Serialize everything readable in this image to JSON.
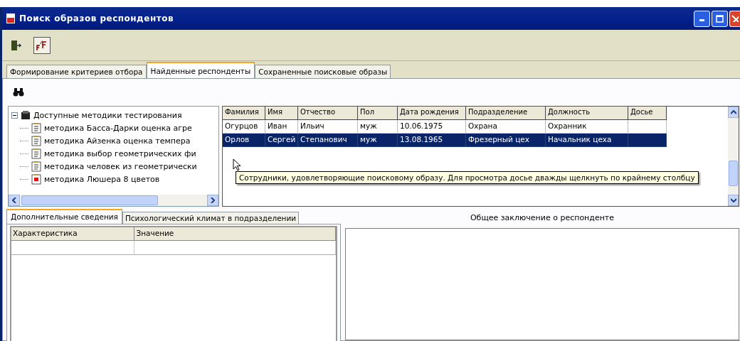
{
  "window": {
    "title": "Поиск образов респондентов"
  },
  "tabs": [
    {
      "label": "Формирование критериев отбора",
      "selected": false
    },
    {
      "label": "Найденные респонденты",
      "selected": true
    },
    {
      "label": "Сохраненные поисковые образы",
      "selected": false
    }
  ],
  "tree": {
    "label": "Доступные методики тестирования",
    "expanded": true,
    "children": [
      {
        "label": "методика Басса-Дарки оценка агре",
        "kind": "document"
      },
      {
        "label": "методика Айзенка оценка темпера",
        "kind": "document"
      },
      {
        "label": "методика выбор геометрических фи",
        "kind": "document"
      },
      {
        "label": "методика человек из геометрически",
        "kind": "document"
      },
      {
        "label": "методика Люшера 8 цветов",
        "kind": "color"
      }
    ]
  },
  "grid": {
    "columns": [
      "Фамилия",
      "Имя",
      "Отчество",
      "Пол",
      "Дата рождения",
      "Подразделение",
      "Должность",
      "Досье"
    ],
    "rows": [
      {
        "cells": [
          "Огурцов",
          "Иван",
          "Ильич",
          "муж",
          "10.06.1975",
          "Охрана",
          "Охранник"
        ],
        "selected": false
      },
      {
        "cells": [
          "Орлов",
          "Сергей",
          "Степанович",
          "муж",
          "13.08.1965",
          "Фрезерный цех",
          "Начальник цеха"
        ],
        "selected": true
      }
    ],
    "tooltip": "Сотрудники, удовлетворяющие поисковому образу. Для просмотра досье дважды щелкнуть по крайнему столбцу"
  },
  "bottom_tabs": [
    {
      "label": "Дополнительные сведения",
      "selected": true
    },
    {
      "label": "Психологический климат в подразделении",
      "selected": false
    }
  ],
  "details_table": {
    "columns": [
      "Характеристика",
      "Значение"
    ]
  },
  "conclusion": {
    "title": "Общее заключение о респонденте"
  }
}
